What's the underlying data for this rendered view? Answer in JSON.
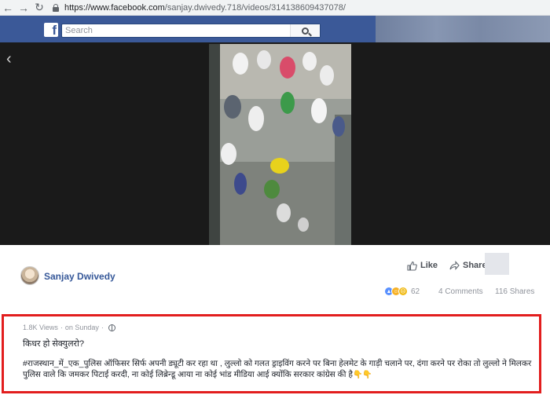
{
  "browser": {
    "url_host": "https://www.facebook.com",
    "url_path": "/sanjay.dwivedy.718/videos/314138609437078/"
  },
  "header": {
    "logo": "f",
    "search_placeholder": "Search"
  },
  "post": {
    "author": "Sanjay Dwivedy",
    "like_label": "Like",
    "share_label": "Share",
    "reaction_count": "62",
    "comments": "4 Comments",
    "shares": "116 Shares",
    "views": "1.8K Views",
    "separator": "·",
    "time": "on Sunday",
    "line1": "किधर हो सेक्युलरो?",
    "body": "#राजस्थान_में_एक_पुलिस ऑफिसर सिर्फ अपनी ड्यूटी कर रहा था , लुल्लो को गलत ड्राइविंग करने पर बिना हेलमेट के गाड़ी चलाने पर, दंगा करने पर रोका तो लुल्लो ने मिलकर पुलिस वाले कि जमकर पिटाई करदी, ना कोई लिब्रेन्डू आया ना कोई भांड मीडिया आई क्योंकि सरकार कांग्रेस की है",
    "body_emoji": "👇👇"
  },
  "colors": {
    "fb_blue": "#3b5998",
    "link_blue": "#365899",
    "highlight_border": "#e21e1e"
  }
}
